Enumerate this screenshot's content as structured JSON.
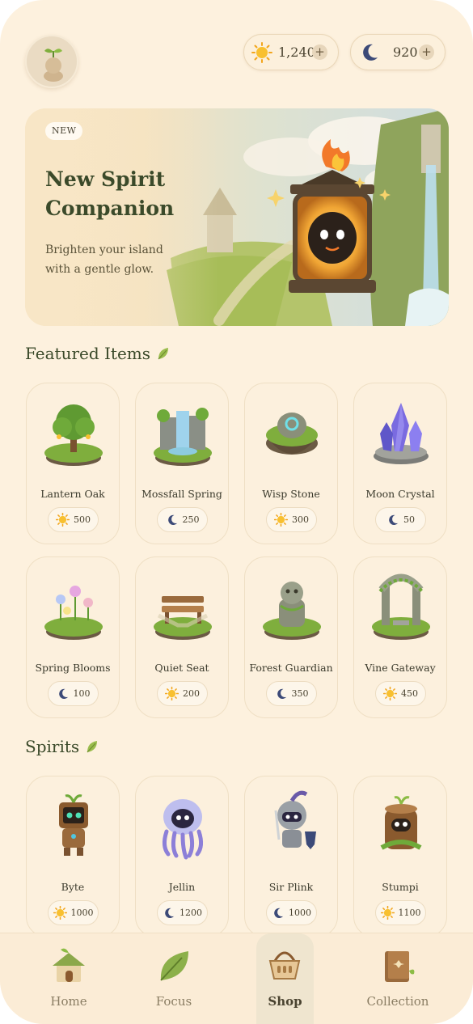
{
  "header": {
    "avatar_icon": "sprout-spirit-avatar-icon",
    "sun_balance": "1,240",
    "moon_balance": "920",
    "add_label": "+"
  },
  "banner": {
    "badge": "NEW",
    "title": "New Spirit Companion",
    "subtitle": "Brighten your island with a gentle glow."
  },
  "featured": {
    "title": "Featured Items",
    "items": [
      {
        "name": "Lantern Oak",
        "currency": "sun",
        "price": "500"
      },
      {
        "name": "Mossfall Spring",
        "currency": "moon",
        "price": "250"
      },
      {
        "name": "Wisp Stone",
        "currency": "sun",
        "price": "300"
      },
      {
        "name": "Moon Crystal",
        "currency": "moon",
        "price": "50"
      },
      {
        "name": "Spring Blooms",
        "currency": "moon",
        "price": "100"
      },
      {
        "name": "Quiet Seat",
        "currency": "sun",
        "price": "200"
      },
      {
        "name": "Forest Guardian",
        "currency": "moon",
        "price": "350"
      },
      {
        "name": "Vine Gateway",
        "currency": "sun",
        "price": "450"
      }
    ]
  },
  "spirits": {
    "title": "Spirits",
    "items": [
      {
        "name": "Byte",
        "currency": "sun",
        "price": "1000"
      },
      {
        "name": "Jellin",
        "currency": "moon",
        "price": "1200"
      },
      {
        "name": "Sir Plink",
        "currency": "moon",
        "price": "1000"
      },
      {
        "name": "Stumpi",
        "currency": "sun",
        "price": "1100"
      }
    ]
  },
  "nav": {
    "items": [
      {
        "label": "Home",
        "icon": "home-icon"
      },
      {
        "label": "Focus",
        "icon": "leaf-icon"
      },
      {
        "label": "Shop",
        "icon": "basket-icon",
        "active": true
      },
      {
        "label": "Collection",
        "icon": "book-icon"
      }
    ]
  },
  "colors": {
    "background": "#fdf1de",
    "accent_green": "#3b4a2a",
    "sun": "#f5b623",
    "moon": "#3c4a78"
  }
}
